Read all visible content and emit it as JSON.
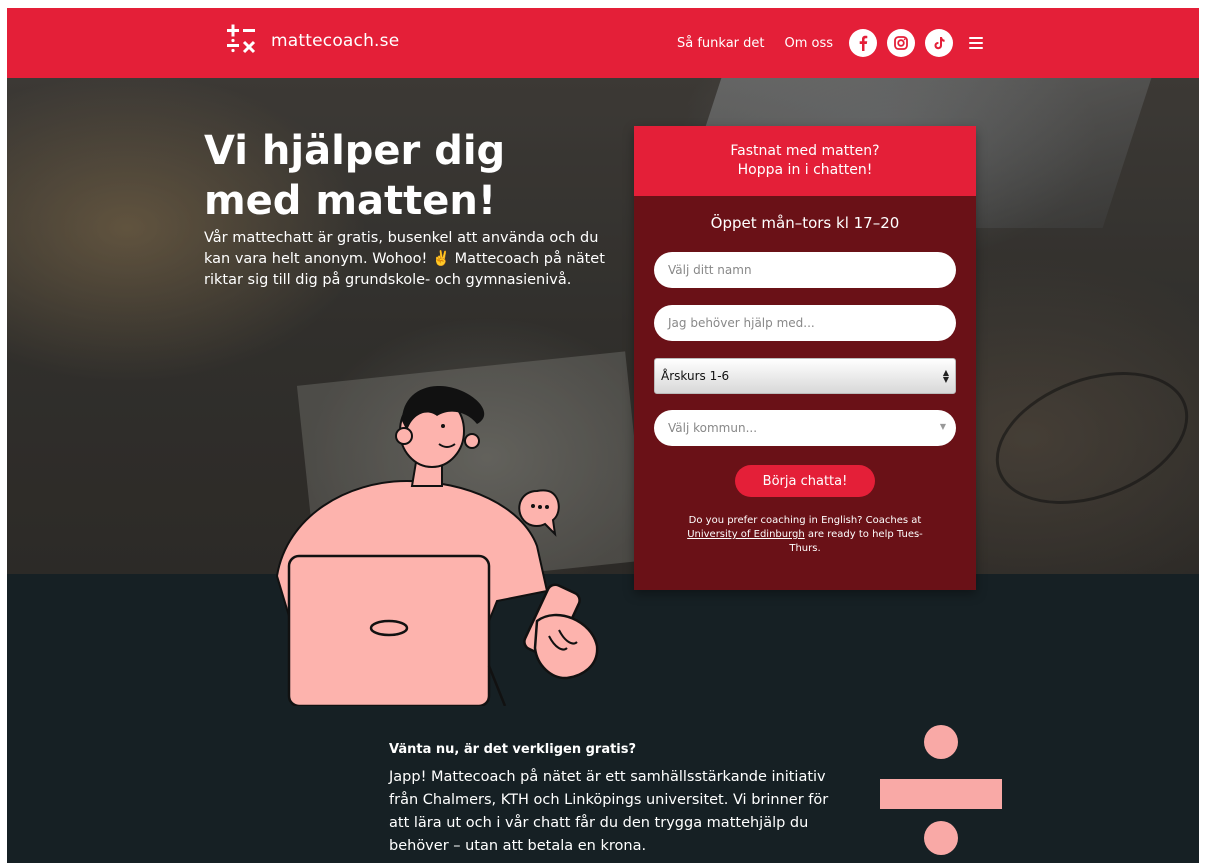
{
  "header": {
    "logo_text": "mattecoach.se",
    "nav": [
      "Så funkar det",
      "Om oss"
    ],
    "social_icons": [
      "facebook-icon",
      "instagram-icon",
      "tiktok-icon"
    ],
    "menu_icon": "hamburger-menu-icon"
  },
  "hero": {
    "title": "Vi hjälper dig med matten!",
    "text": "Vår mattechatt är gratis, busenkel att använda och du kan vara helt anonym. Wohoo! ✌️ Mattecoach på nätet riktar sig till dig på grundskole- och gymnasienivå."
  },
  "chat": {
    "head_line1": "Fastnat med matten?",
    "head_line2": "Hoppa in i chatten!",
    "open_hours": "Öppet mån–tors kl 17–20",
    "name_placeholder": "Välj ditt namn",
    "help_placeholder": "Jag behöver hjälp med...",
    "grade_selected": "Årskurs 1-6",
    "kommun_placeholder": "Välj kommun...",
    "start_button": "Börja chatta!",
    "english_pre": "Do you prefer coaching in English? Coaches at",
    "english_link": "University of Edinburgh",
    "english_post": "are ready to help Tues-Thurs."
  },
  "info": {
    "title": "Vänta nu, är det verkligen gratis?",
    "text": "Japp! Mattecoach på nätet är ett samhällsstärkande initiativ från Chalmers, KTH och Linköpings universitet. Vi brinner för att lära ut och i vår chatt får du den trygga mattehjälp du behöver – utan att betala en krona."
  },
  "colors": {
    "brand_red": "#e41f38",
    "dark_red": "#6a1117",
    "dark_bg": "#162024",
    "accent_pink": "#f9a9a6"
  }
}
